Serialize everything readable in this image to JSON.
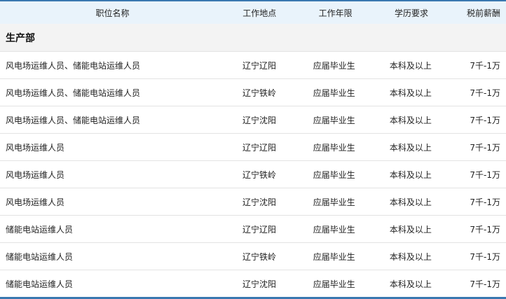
{
  "header": {
    "position": "职位名称",
    "location": "工作地点",
    "experience": "工作年限",
    "education": "学历要求",
    "salary": "税前薪酬"
  },
  "section": {
    "title": "生产部"
  },
  "rows": [
    {
      "position": "风电场运维人员、储能电站运维人员",
      "location": "辽宁辽阳",
      "experience": "应届毕业生",
      "education": "本科及以上",
      "salary": "7千-1万"
    },
    {
      "position": "风电场运维人员、储能电站运维人员",
      "location": "辽宁铁岭",
      "experience": "应届毕业生",
      "education": "本科及以上",
      "salary": "7千-1万"
    },
    {
      "position": "风电场运维人员、储能电站运维人员",
      "location": "辽宁沈阳",
      "experience": "应届毕业生",
      "education": "本科及以上",
      "salary": "7千-1万"
    },
    {
      "position": "风电场运维人员",
      "location": "辽宁辽阳",
      "experience": "应届毕业生",
      "education": "本科及以上",
      "salary": "7千-1万"
    },
    {
      "position": "风电场运维人员",
      "location": "辽宁铁岭",
      "experience": "应届毕业生",
      "education": "本科及以上",
      "salary": "7千-1万"
    },
    {
      "position": "风电场运维人员",
      "location": "辽宁沈阳",
      "experience": "应届毕业生",
      "education": "本科及以上",
      "salary": "7千-1万"
    },
    {
      "position": "储能电站运维人员",
      "location": "辽宁辽阳",
      "experience": "应届毕业生",
      "education": "本科及以上",
      "salary": "7千-1万"
    },
    {
      "position": "储能电站运维人员",
      "location": "辽宁铁岭",
      "experience": "应届毕业生",
      "education": "本科及以上",
      "salary": "7千-1万"
    },
    {
      "position": "储能电站运维人员",
      "location": "辽宁沈阳",
      "experience": "应届毕业生",
      "education": "本科及以上",
      "salary": "7千-1万"
    }
  ],
  "colors": {
    "accent": "#3a78b0",
    "header_bg": "#e9f3fb",
    "section_bg": "#f3f3f3"
  }
}
